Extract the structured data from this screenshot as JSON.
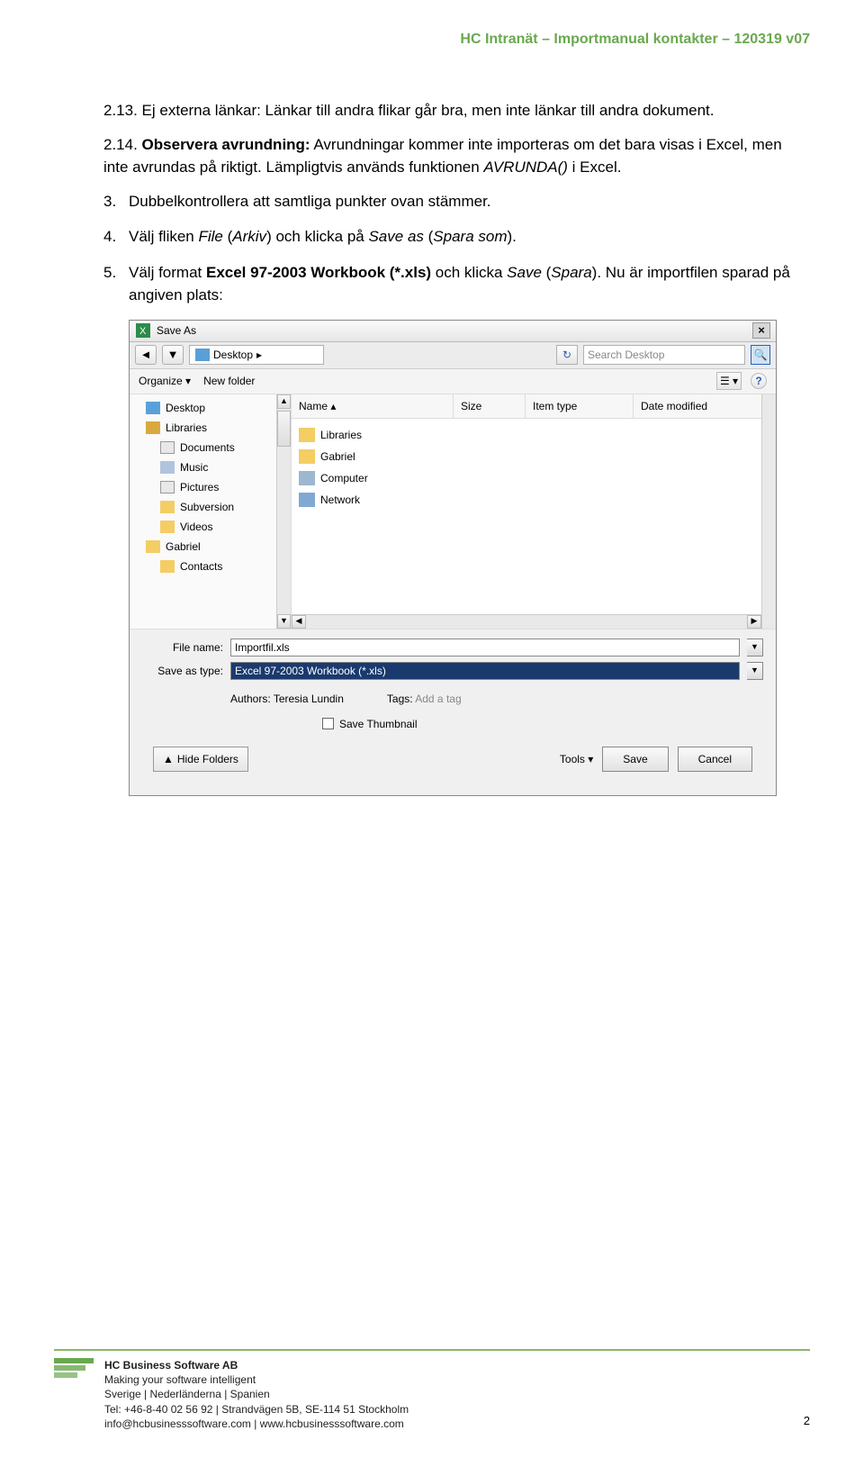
{
  "header": {
    "doc_title": "HC Intranät – Importmanual kontakter – 120319 v07"
  },
  "paragraphs": {
    "p213_num": "2.13.",
    "p213_text": "Ej externa länkar: Länkar till andra flikar går bra, men inte länkar till andra dokument.",
    "p214_num": "2.14.",
    "p214_label": "Observera avrundning:",
    "p214_text": " Avrundningar kommer inte importeras om det bara visas i Excel, men inte avrundas på riktigt. Lämpligtvis används funktionen ",
    "p214_func": "AVRUNDA()",
    "p214_tail": " i Excel."
  },
  "steps": {
    "s3_num": "3.",
    "s3_text": "Dubbelkontrollera att samtliga punkter ovan stämmer.",
    "s4_num": "4.",
    "s4_a": "Välj fliken ",
    "s4_file": "File",
    "s4_arkiv": "Arkiv",
    "s4_b": " och klicka på ",
    "s4_saveas": "Save as",
    "s4_sparasom": "Spara som",
    "s5_num": "5.",
    "s5_a": "Välj format ",
    "s5_bold": "Excel 97-2003 Workbook (*.xls)",
    "s5_b": " och klicka ",
    "s5_save": "Save",
    "s5_spara": "Spara",
    "s5_tail": ". Nu är importfilen sparad på angiven plats:"
  },
  "dialog": {
    "title": "Save As",
    "close": "×",
    "back": "◄",
    "fwd": "▼",
    "breadcrumb_label": "Desktop",
    "breadcrumb_arrow": "▸",
    "refresh_glyph": "↻",
    "search_placeholder": "Search Desktop",
    "magnify_glyph": "🔍",
    "organize": "Organize ▾",
    "newfolder": "New folder",
    "view_glyph": "☰ ▾",
    "help_glyph": "?",
    "tree": {
      "desktop": "Desktop",
      "libraries": "Libraries",
      "documents": "Documents",
      "music": "Music",
      "pictures": "Pictures",
      "subversion": "Subversion",
      "videos": "Videos",
      "gabriel": "Gabriel",
      "contacts": "Contacts"
    },
    "cols": {
      "name": "Name ▴",
      "size": "Size",
      "type": "Item type",
      "date": "Date modified"
    },
    "rows": {
      "libraries": "Libraries",
      "gabriel": "Gabriel",
      "computer": "Computer",
      "network": "Network"
    },
    "filename_label": "File name:",
    "filename_value": "Importfil.xls",
    "savetype_label": "Save as type:",
    "savetype_value": "Excel 97-2003 Workbook (*.xls)",
    "authors_label": "Authors:",
    "authors_value": "Teresia Lundin",
    "tags_label": "Tags:",
    "tags_value": "Add a tag",
    "thumb_label": "Save Thumbnail",
    "hide_folders": "Hide Folders",
    "tools": "Tools ▾",
    "save_btn": "Save",
    "cancel_btn": "Cancel"
  },
  "footer": {
    "company": "HC Business Software AB",
    "tagline": "Making your software intelligent",
    "countries": "Sverige | Nederländerna | Spanien",
    "address": "Tel: +46-8-40 02 56 92 | Strandvägen 5B, SE-114 51 Stockholm",
    "contact": "info@hcbusinesssoftware.com | www.hcbusinesssoftware.com",
    "page": "2"
  }
}
